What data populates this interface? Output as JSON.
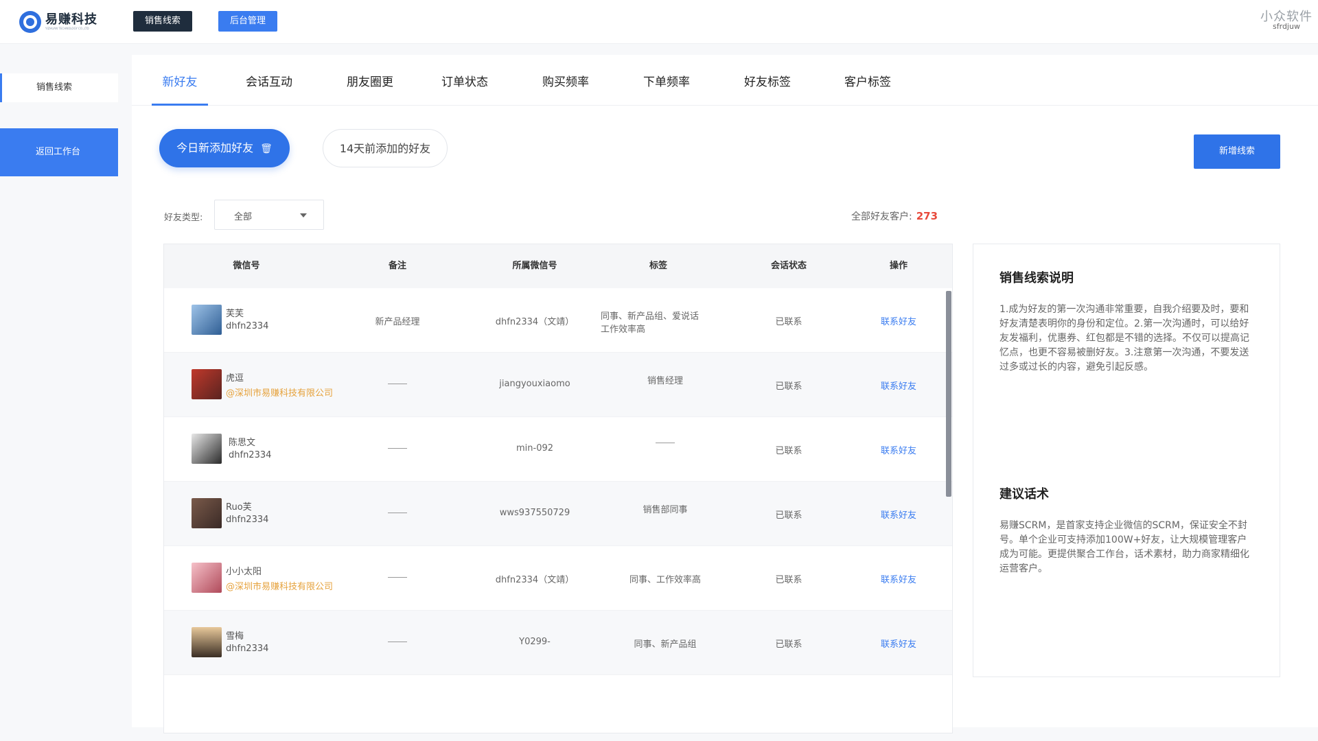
{
  "app": {
    "logo_name": "易赚科技",
    "logo_sub": "YIZHUAN TECHNOLOGY CO.,LTD"
  },
  "topnav": {
    "btn_leads": "销售线索",
    "btn_admin": "后台管理"
  },
  "watermark": {
    "main": "小众软件",
    "sub": "sfrdjuw"
  },
  "sidebar": {
    "item_leads": "销售线索",
    "back": "返回工作台"
  },
  "tabs": [
    {
      "label": "新好友"
    },
    {
      "label": "会话互动"
    },
    {
      "label": "朋友圈更新"
    },
    {
      "label": "订单状态"
    },
    {
      "label": "购买频率"
    },
    {
      "label": "下单频率"
    },
    {
      "label": "好友标签"
    },
    {
      "label": "客户标签"
    }
  ],
  "filters": {
    "today_btn": "今日新添加好友",
    "trash_icon": "trash-icon",
    "days14_btn": "14天前添加的好友",
    "new_lead_btn": "新增线索",
    "type_label": "好友类型:",
    "type_value": "全部",
    "total_label": "全部好友客户:",
    "total_value": "273"
  },
  "table": {
    "headers": [
      "微信号",
      "备注",
      "所属微信号",
      "标签",
      "会话状态",
      "操作"
    ],
    "rows": [
      {
        "name": "芙芙",
        "sub": "dhfn2334",
        "note": "新产品经理",
        "owner": "dhfn2334（文靖）",
        "tags": "同事、新产品组、爱说话",
        "tags2": "工作效率高",
        "status": "已联系",
        "action": "联系好友"
      },
      {
        "name": "虎逗",
        "sub": "@深圳市易赚科技有限公司",
        "note": "",
        "owner": "jiangyouxiaomo",
        "tags": "销售经理",
        "tags2": "",
        "status": "已联系",
        "action": "联系好友"
      },
      {
        "name": "陈思文",
        "sub": "dhfn2334",
        "note": "",
        "owner": "min-092",
        "tags": "",
        "tags2": "",
        "status": "已联系",
        "action": "联系好友"
      },
      {
        "name": "Ruo芙",
        "sub": "dhfn2334",
        "note": "",
        "owner": "wws937550729",
        "tags": "销售部同事",
        "tags2": "",
        "status": "已联系",
        "action": "联系好友"
      },
      {
        "name": "小小太阳",
        "sub": "@深圳市易赚科技有限公司",
        "note": "",
        "owner": "dhfn2334（文靖）",
        "tags": "同事、工作效率高",
        "tags2": "",
        "status": "已联系",
        "action": "联系好友"
      },
      {
        "name": "雪梅",
        "sub": "dhfn2334",
        "note": "",
        "owner": "Y0299-",
        "tags": "同事、新产品组",
        "tags2": "",
        "status": "已联系",
        "action": "联系好友"
      }
    ]
  },
  "panel": {
    "title1": "销售线索说明",
    "text1": "1.成为好友的第一次沟通非常重要，自我介绍要及时，要和好友清楚表明你的身份和定位。2.第一次沟通时，可以给好友发福利，优惠券、红包都是不错的选择。不仅可以提高记忆点，也更不容易被删好友。3.注意第一次沟通，不要发送过多或过长的内容，避免引起反感。",
    "title2": "建议话术",
    "text2": "易赚SCRM，是首家支持企业微信的SCRM，保证安全不封号。单个企业可支持添加100W+好友，让大规模管理客户成为可能。更提供聚合工作台，话术素材，助力商家精细化运营客户。"
  },
  "colors": {
    "accent": "#3a7cf0",
    "dark": "#1f2d3d",
    "total_red": "#e84a3c",
    "company_orange": "#e6a23c"
  }
}
